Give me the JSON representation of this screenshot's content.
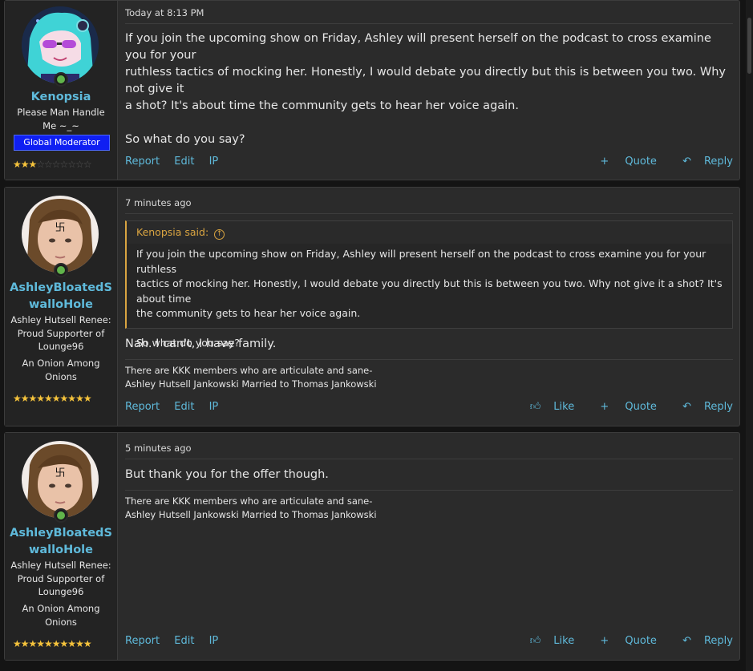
{
  "posts": [
    {
      "timestamp": "Today at 8:13 PM",
      "username": "Kenopsia",
      "user_title": "Please Man Handle Me ~_~",
      "badge": "Global Moderator",
      "stars_filled": 3,
      "stars_total": 10,
      "message_lines": [
        "If you join the upcoming show on Friday, Ashley will present herself on the podcast to cross examine you for your",
        "ruthless tactics of mocking her. Honestly, I would debate you directly but this is between you two. Why not give it",
        "a shot? It's about time the community gets to hear her voice again.",
        "",
        "So what do you say?"
      ],
      "actions": {
        "report": "Report",
        "edit": "Edit",
        "ip": "IP",
        "quote": "Quote",
        "reply": "Reply"
      }
    },
    {
      "timestamp": "7 minutes ago",
      "username_line1": "AshleyBloatedS",
      "username_line2": "walloHole",
      "user_title_lines": [
        "Ashley Hutsell Renee:",
        "Proud Supporter of",
        "Lounge96"
      ],
      "rank_lines": [
        "An Onion Among",
        "Onions"
      ],
      "stars_filled": 10,
      "stars_total": 10,
      "quote": {
        "author": "Kenopsia said:",
        "lines": [
          "If you join the upcoming show on Friday, Ashley will present herself on the podcast to cross examine you for your ruthless",
          "tactics of mocking her. Honestly, I would debate you directly but this is between you two. Why not give it a shot? It's about time",
          "the community gets to hear her voice again.",
          "",
          "So what do you say?"
        ]
      },
      "message": "Nah. I can't, I have family.",
      "signature": [
        "There are KKK members who are articulate and sane-",
        "Ashley Hutsell Jankowski Married to Thomas Jankowski"
      ],
      "actions": {
        "report": "Report",
        "edit": "Edit",
        "ip": "IP",
        "like": "Like",
        "quote": "Quote",
        "reply": "Reply"
      }
    },
    {
      "timestamp": "5 minutes ago",
      "username_line1": "AshleyBloatedS",
      "username_line2": "walloHole",
      "user_title_lines": [
        "Ashley Hutsell Renee:",
        "Proud Supporter of",
        "Lounge96"
      ],
      "rank_lines": [
        "An Onion Among",
        "Onions"
      ],
      "stars_filled": 10,
      "stars_total": 10,
      "message": "But thank you for the offer though.",
      "signature": [
        "There are KKK members who are articulate and sane-",
        "Ashley Hutsell Jankowski Married to Thomas Jankowski"
      ],
      "actions": {
        "report": "Report",
        "edit": "Edit",
        "ip": "IP",
        "like": "Like",
        "quote": "Quote",
        "reply": "Reply"
      }
    }
  ],
  "colors": {
    "link": "#5fbadb",
    "quote_accent": "#d9a441",
    "badge": "#0f1ff2",
    "online": "#61b44b",
    "star": "#f5c33c"
  },
  "icons": {
    "online": "online-dot-icon",
    "star": "star-icon",
    "like": "thumbs-up-icon",
    "quote": "plus-icon",
    "reply": "reply-arrow-icon",
    "quote_source": "up-arrow-circle-icon"
  }
}
